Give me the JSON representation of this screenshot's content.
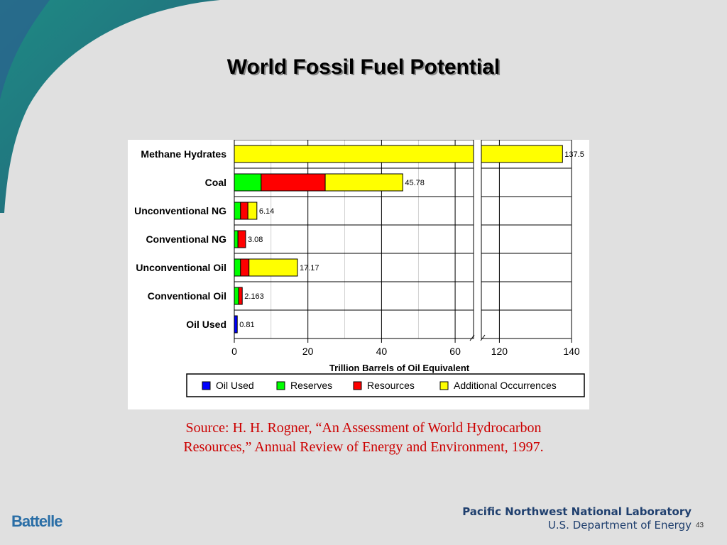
{
  "slide": {
    "title": "World Fossil Fuel Potential",
    "source_line1": "Source: H. H. Rogner, “An Assessment of World Hydrocarbon",
    "source_line2": "Resources,” Annual Review of Energy and Environment, 1997.",
    "logo_left": "Battelle",
    "footer_org": "Pacific Northwest National Laboratory",
    "footer_dept": "U.S. Department of Energy",
    "page_number": "43"
  },
  "colors": {
    "background": "#e0e0e0",
    "swoosh_teal": "#1e7e82",
    "swoosh_blue": "#2c4f8f",
    "source_text": "#cc0000",
    "footer_text": "#1f3f6e"
  },
  "chart_data": {
    "type": "bar",
    "orientation": "horizontal",
    "stacked": true,
    "title": "",
    "xlabel": "Trillion Barrels of Oil Equivalent",
    "ylabel": "",
    "categories": [
      "Methane Hydrates",
      "Coal",
      "Unconventional NG",
      "Conventional NG",
      "Unconventional Oil",
      "Conventional Oil",
      "Oil Used"
    ],
    "totals_labels": [
      "137.5",
      "45.78",
      "6.14",
      "3.08",
      "17.17",
      "2.163",
      "0.81"
    ],
    "series": [
      {
        "name": "Oil Used",
        "color": "#0000ff",
        "values": [
          0,
          0,
          0,
          0,
          0,
          0,
          0.81
        ]
      },
      {
        "name": "Reserves",
        "color": "#00ff00",
        "values": [
          0,
          7.3,
          1.7,
          1.0,
          1.7,
          1.2,
          0
        ]
      },
      {
        "name": "Resources",
        "color": "#ff0000",
        "values": [
          0,
          17.4,
          2.0,
          2.08,
          2.3,
          0.963,
          0
        ]
      },
      {
        "name": "Additional Occurrences",
        "color": "#ffff00",
        "values": [
          137.5,
          21.08,
          2.44,
          0,
          13.17,
          0,
          0
        ]
      }
    ],
    "axis": {
      "broken": true,
      "segment1": {
        "min": 0,
        "max": 65,
        "ticks": [
          0,
          20,
          40,
          60
        ]
      },
      "segment2": {
        "min": 115,
        "max": 140,
        "ticks": [
          120,
          140
        ]
      }
    },
    "grid": true,
    "legend_position": "bottom"
  }
}
